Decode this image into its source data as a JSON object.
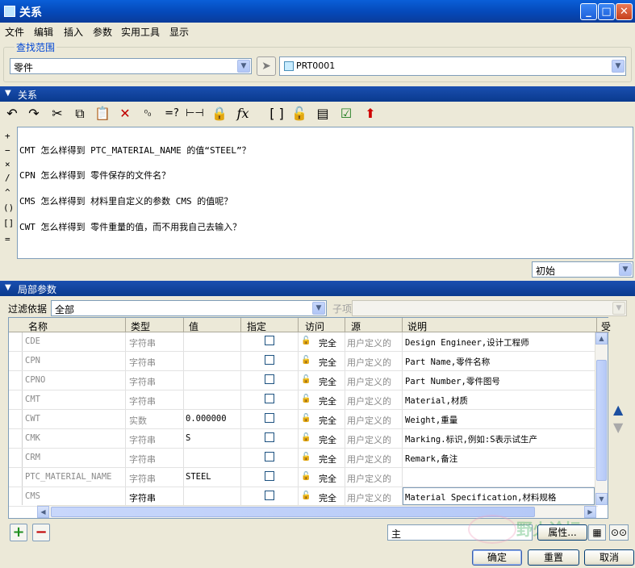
{
  "window": {
    "title": "关系",
    "minimize": "_",
    "maximize": "□",
    "close": "✕"
  },
  "menu": [
    "文件",
    "编辑",
    "插入",
    "参数",
    "实用工具",
    "显示"
  ],
  "scope": {
    "group_label": "查找范围",
    "type_value": "零件",
    "model_value": "PRT0001"
  },
  "relations_section": {
    "label": "关系",
    "side_ops": [
      "+",
      "−",
      "×",
      "/",
      "^",
      "()",
      "[]",
      "="
    ],
    "lines": [
      "CMT 怎么样得到 PTC_MATERIAL_NAME 的值“STEEL”？",
      "CPN 怎么样得到 零件保存的文件名？",
      "CMS 怎么样得到 材料里自定义的参数 CMS 的值呢？",
      "CWT 怎么样得到 零件重量的值，而不用我自己去输入？"
    ],
    "state_value": "初始"
  },
  "params_section": {
    "label": "局部参数",
    "filter_label": "过滤依据",
    "filter_value": "全部",
    "subitem_label": "子项",
    "columns": [
      "名称",
      "类型",
      "值",
      "指定",
      "访问",
      "源",
      "说明",
      "受"
    ],
    "rows": [
      {
        "name": "CDE",
        "type": "字符串",
        "value": "",
        "access": "完全",
        "source": "用户定义的",
        "desc": "Design Engineer,设计工程师"
      },
      {
        "name": "CPN",
        "type": "字符串",
        "value": "",
        "access": "完全",
        "source": "用户定义的",
        "desc": "Part Name,零件名称"
      },
      {
        "name": "CPNO",
        "type": "字符串",
        "value": "",
        "access": "完全",
        "source": "用户定义的",
        "desc": "Part Number,零件图号"
      },
      {
        "name": "CMT",
        "type": "字符串",
        "value": "",
        "access": "完全",
        "source": "用户定义的",
        "desc": "Material,材质"
      },
      {
        "name": "CWT",
        "type": "实数",
        "value": "0.000000",
        "access": "完全",
        "source": "用户定义的",
        "desc": "Weight,重量"
      },
      {
        "name": "CMK",
        "type": "字符串",
        "value": "S",
        "access": "完全",
        "source": "用户定义的",
        "desc": "Marking.标识,例如:S表示试生产"
      },
      {
        "name": "CRM",
        "type": "字符串",
        "value": "",
        "access": "完全",
        "source": "用户定义的",
        "desc": "Remark,备注"
      },
      {
        "name": "PTC_MATERIAL_NAME",
        "type": "字符串",
        "value": "STEEL",
        "access": "完全",
        "source": "用户定义的",
        "desc": ""
      },
      {
        "name": "CMS",
        "type": "字符串",
        "value": "",
        "access": "完全",
        "source": "用户定义的",
        "desc": "Material Specification,材料规格"
      }
    ],
    "main_value": "主",
    "properties_label": "属性..."
  },
  "footer": {
    "ok": "确定",
    "reset": "重置",
    "cancel": "取消"
  },
  "watermark": "野火论坛 www.proewildfire.cn",
  "colors": {
    "section_bar": "#0a3a8e",
    "title_bar": "#0548b8",
    "group_label": "#0046d5"
  }
}
